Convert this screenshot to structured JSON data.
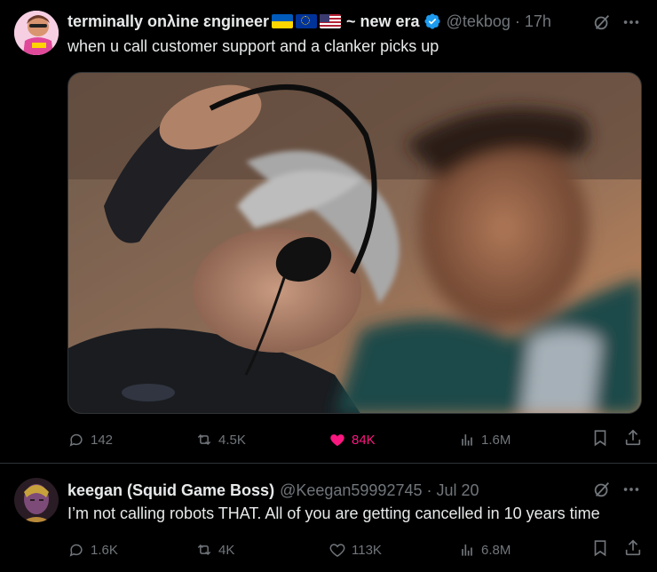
{
  "post1": {
    "author_name": "terminally onλine ɛngineer",
    "name_suffix": "~ new era",
    "handle": "@tekbog",
    "time": "17h",
    "text": "when u call customer support and a clanker picks up",
    "stats": {
      "replies": "142",
      "reposts": "4.5K",
      "likes": "84K",
      "views": "1.6M"
    },
    "liked": true
  },
  "post2": {
    "author_name": "keegan (Squid Game Boss)",
    "handle": "@Keegan59992745",
    "time": "Jul 20",
    "text": "I’m not calling robots THAT. All of you are getting cancelled in 10 years time",
    "stats": {
      "replies": "1.6K",
      "reposts": "4K",
      "likes": "113K",
      "views": "6.8M"
    }
  },
  "colors": {
    "background": "#000000",
    "text": "#e7e9ea",
    "muted": "#71767b",
    "like": "#f91880",
    "verified": "#1d9bf0",
    "divider": "#2f3336"
  }
}
